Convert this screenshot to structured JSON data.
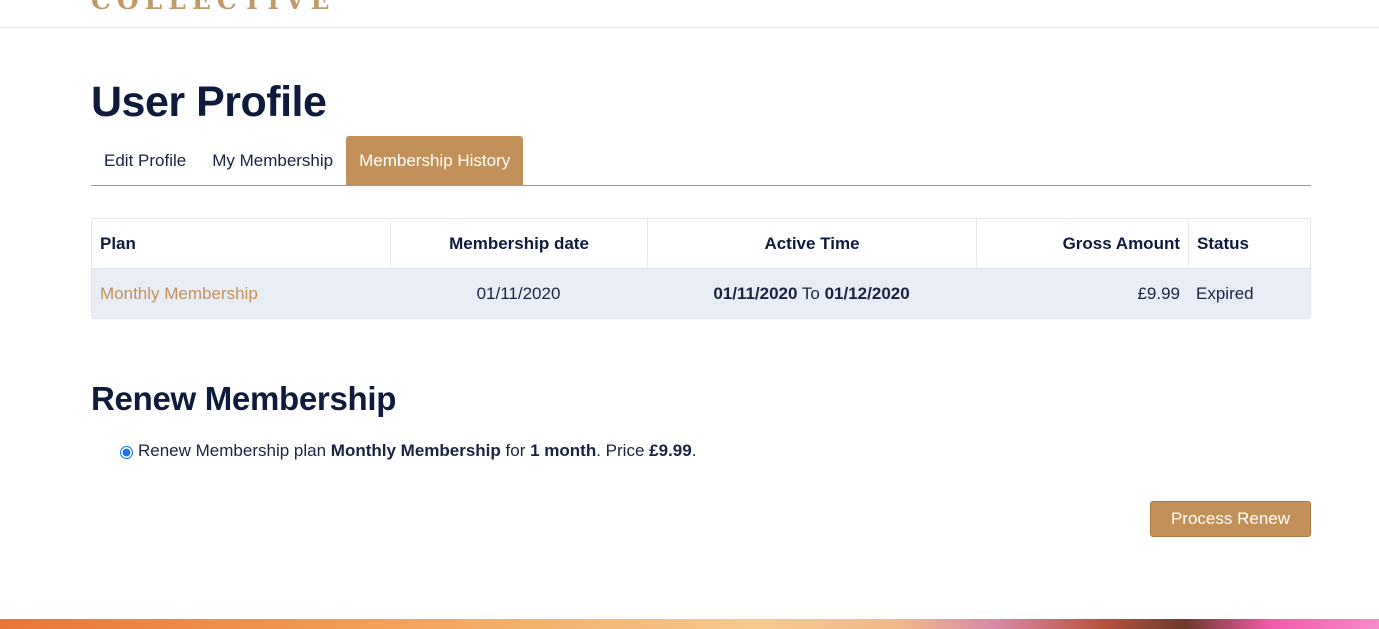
{
  "header": {
    "brand_text": "COLLECTIVE"
  },
  "page": {
    "title": "User Profile"
  },
  "tabs": [
    {
      "label": "Edit Profile",
      "active": false
    },
    {
      "label": "My Membership",
      "active": false
    },
    {
      "label": "Membership History",
      "active": true
    }
  ],
  "history_table": {
    "columns": [
      "Plan",
      "Membership date",
      "Active Time",
      "Gross Amount",
      "Status"
    ],
    "rows": [
      {
        "plan": "Monthly Membership",
        "membership_date": "01/11/2020",
        "active_from": "01/11/2020",
        "active_to_word": "To",
        "active_to": "01/12/2020",
        "gross_amount": "£9.99",
        "status": "Expired"
      }
    ]
  },
  "renew": {
    "title": "Renew Membership",
    "option": {
      "prefix": "Renew Membership plan",
      "plan_name": "Monthly Membership",
      "for_word": "for",
      "duration": "1 month",
      "price_prefix": ". Price",
      "price": "£9.99",
      "suffix": ".",
      "selected": true
    },
    "button_label": "Process Renew"
  },
  "colors": {
    "accent": "#c19159",
    "heading": "#0f1b3d",
    "row_background": "#e9eef6"
  }
}
